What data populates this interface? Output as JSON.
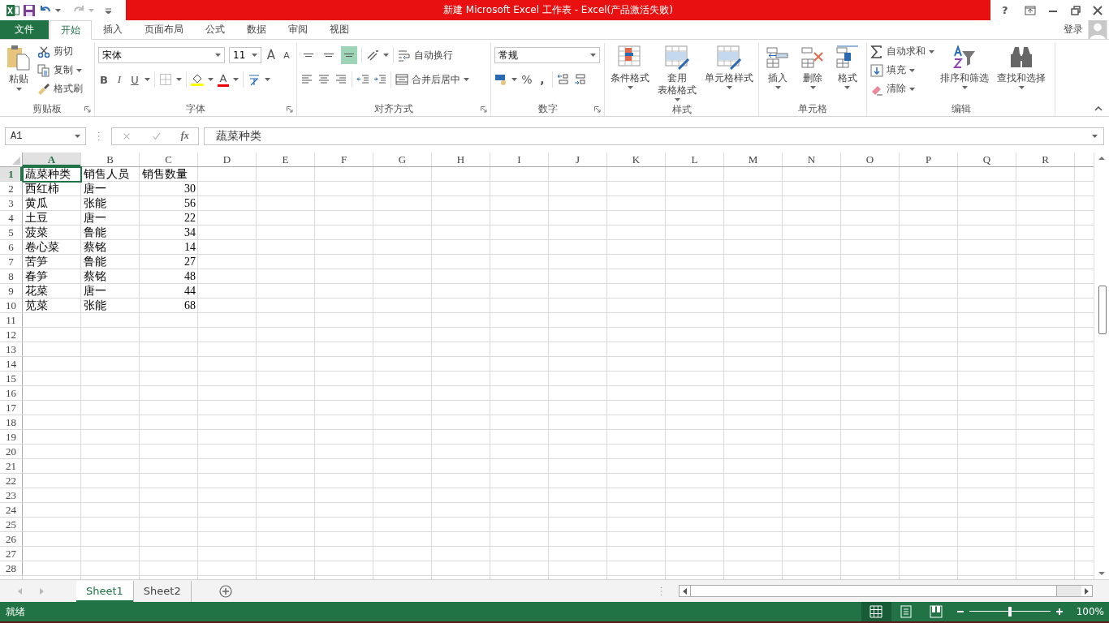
{
  "title_bar": {
    "title": "新建 Microsoft Excel 工作表 -  Excel(产品激活失败)",
    "help": "?"
  },
  "tabs": [
    {
      "label": "文件",
      "kind": "file",
      "selected": false
    },
    {
      "label": "开始",
      "kind": "tab",
      "selected": true
    },
    {
      "label": "插入",
      "kind": "tab",
      "selected": false
    },
    {
      "label": "页面布局",
      "kind": "tab",
      "selected": false
    },
    {
      "label": "公式",
      "kind": "tab",
      "selected": false
    },
    {
      "label": "数据",
      "kind": "tab",
      "selected": false
    },
    {
      "label": "审阅",
      "kind": "tab",
      "selected": false
    },
    {
      "label": "视图",
      "kind": "tab",
      "selected": false
    }
  ],
  "account": {
    "sign_in": "登录"
  },
  "ribbon": {
    "clipboard": {
      "label": "剪贴板",
      "paste": "粘贴",
      "cut": "剪切",
      "copy": "复制",
      "format_painter": "格式刷"
    },
    "font": {
      "label": "字体",
      "font_name": "宋体",
      "font_size": "11",
      "grow": "A",
      "shrink": "A",
      "bold": "B",
      "italic": "I",
      "underline": "U",
      "font_color": "A"
    },
    "alignment": {
      "label": "对齐方式",
      "vertical": [
        {
          "selected": false
        },
        {
          "selected": false
        },
        {
          "selected": true
        }
      ],
      "wrap_text": "自动换行",
      "merge_center": "合并后居中"
    },
    "number": {
      "label": "数字",
      "format": "常规",
      "percent": "%",
      "comma": ","
    },
    "styles": {
      "label": "样式",
      "buttons": [
        {
          "lines": [
            "条件格式"
          ]
        },
        {
          "lines": [
            "套用",
            "表格格式"
          ]
        },
        {
          "lines": [
            "单元格样式"
          ]
        }
      ]
    },
    "cells": {
      "label": "单元格",
      "buttons": [
        "插入",
        "删除",
        "格式"
      ]
    },
    "editing": {
      "label": "编辑",
      "autosum": "自动求和",
      "fill": "填充",
      "clear": "清除",
      "sort_filter": "排序和筛选",
      "find_select": "查找和选择"
    }
  },
  "formula_bar": {
    "name_box": "A1",
    "function": "fx",
    "content": "蔬菜种类"
  },
  "sheet": {
    "columns": [
      {
        "label": "A",
        "selected": true
      },
      {
        "label": "B",
        "selected": false
      },
      {
        "label": "C",
        "selected": false
      },
      {
        "label": "D",
        "selected": false
      },
      {
        "label": "E",
        "selected": false
      },
      {
        "label": "F",
        "selected": false
      },
      {
        "label": "G",
        "selected": false
      },
      {
        "label": "H",
        "selected": false
      },
      {
        "label": "I",
        "selected": false
      },
      {
        "label": "J",
        "selected": false
      },
      {
        "label": "K",
        "selected": false
      },
      {
        "label": "L",
        "selected": false
      },
      {
        "label": "M",
        "selected": false
      },
      {
        "label": "N",
        "selected": false
      },
      {
        "label": "O",
        "selected": false
      },
      {
        "label": "P",
        "selected": false
      },
      {
        "label": "Q",
        "selected": false
      },
      {
        "label": "R",
        "selected": false
      }
    ],
    "rows": [
      {
        "header": "1",
        "selected": true,
        "cells": [
          {
            "text": "蔬菜种类",
            "right_aligned": false,
            "selected": true
          },
          {
            "text": "销售人员",
            "right_aligned": false,
            "selected": false
          },
          {
            "text": "销售数量",
            "right_aligned": false,
            "selected": false
          }
        ]
      },
      {
        "header": "2",
        "selected": false,
        "cells": [
          {
            "text": "西红柿",
            "right_aligned": false,
            "selected": false
          },
          {
            "text": "唐一",
            "right_aligned": false,
            "selected": false
          },
          {
            "text": "30",
            "right_aligned": true,
            "selected": false
          }
        ]
      },
      {
        "header": "3",
        "selected": false,
        "cells": [
          {
            "text": "黄瓜",
            "right_aligned": false,
            "selected": false
          },
          {
            "text": "张能",
            "right_aligned": false,
            "selected": false
          },
          {
            "text": "56",
            "right_aligned": true,
            "selected": false
          }
        ]
      },
      {
        "header": "4",
        "selected": false,
        "cells": [
          {
            "text": "土豆",
            "right_aligned": false,
            "selected": false
          },
          {
            "text": "唐一",
            "right_aligned": false,
            "selected": false
          },
          {
            "text": "22",
            "right_aligned": true,
            "selected": false
          }
        ]
      },
      {
        "header": "5",
        "selected": false,
        "cells": [
          {
            "text": "菠菜",
            "right_aligned": false,
            "selected": false
          },
          {
            "text": "鲁能",
            "right_aligned": false,
            "selected": false
          },
          {
            "text": "34",
            "right_aligned": true,
            "selected": false
          }
        ]
      },
      {
        "header": "6",
        "selected": false,
        "cells": [
          {
            "text": "卷心菜",
            "right_aligned": false,
            "selected": false
          },
          {
            "text": "蔡铭",
            "right_aligned": false,
            "selected": false
          },
          {
            "text": "14",
            "right_aligned": true,
            "selected": false
          }
        ]
      },
      {
        "header": "7",
        "selected": false,
        "cells": [
          {
            "text": "苦笋",
            "right_aligned": false,
            "selected": false
          },
          {
            "text": "鲁能",
            "right_aligned": false,
            "selected": false
          },
          {
            "text": "27",
            "right_aligned": true,
            "selected": false
          }
        ]
      },
      {
        "header": "8",
        "selected": false,
        "cells": [
          {
            "text": "春笋",
            "right_aligned": false,
            "selected": false
          },
          {
            "text": "蔡铭",
            "right_aligned": false,
            "selected": false
          },
          {
            "text": "48",
            "right_aligned": true,
            "selected": false
          }
        ]
      },
      {
        "header": "9",
        "selected": false,
        "cells": [
          {
            "text": "花菜",
            "right_aligned": false,
            "selected": false
          },
          {
            "text": "唐一",
            "right_aligned": false,
            "selected": false
          },
          {
            "text": "44",
            "right_aligned": true,
            "selected": false
          }
        ]
      },
      {
        "header": "10",
        "selected": false,
        "cells": [
          {
            "text": "苋菜",
            "right_aligned": false,
            "selected": false
          },
          {
            "text": "张能",
            "right_aligned": false,
            "selected": false
          },
          {
            "text": "68",
            "right_aligned": true,
            "selected": false
          }
        ]
      },
      {
        "header": "11",
        "selected": false,
        "cells": []
      },
      {
        "header": "12",
        "selected": false,
        "cells": []
      },
      {
        "header": "13",
        "selected": false,
        "cells": []
      },
      {
        "header": "14",
        "selected": false,
        "cells": []
      },
      {
        "header": "15",
        "selected": false,
        "cells": []
      },
      {
        "header": "16",
        "selected": false,
        "cells": []
      },
      {
        "header": "17",
        "selected": false,
        "cells": []
      },
      {
        "header": "18",
        "selected": false,
        "cells": []
      },
      {
        "header": "19",
        "selected": false,
        "cells": []
      },
      {
        "header": "20",
        "selected": false,
        "cells": []
      },
      {
        "header": "21",
        "selected": false,
        "cells": []
      },
      {
        "header": "22",
        "selected": false,
        "cells": []
      },
      {
        "header": "23",
        "selected": false,
        "cells": []
      },
      {
        "header": "24",
        "selected": false,
        "cells": []
      },
      {
        "header": "25",
        "selected": false,
        "cells": []
      },
      {
        "header": "26",
        "selected": false,
        "cells": []
      },
      {
        "header": "27",
        "selected": false,
        "cells": []
      },
      {
        "header": "28",
        "selected": false,
        "cells": []
      }
    ]
  },
  "sheet_tabs": [
    {
      "label": "Sheet1",
      "selected": true
    },
    {
      "label": "Sheet2",
      "selected": false
    }
  ],
  "status_bar": {
    "status": "就绪",
    "views": [
      {
        "selected": true
      },
      {
        "selected": false
      },
      {
        "selected": false
      }
    ],
    "zoom": {
      "level": 0.5,
      "reading": "100%"
    }
  }
}
